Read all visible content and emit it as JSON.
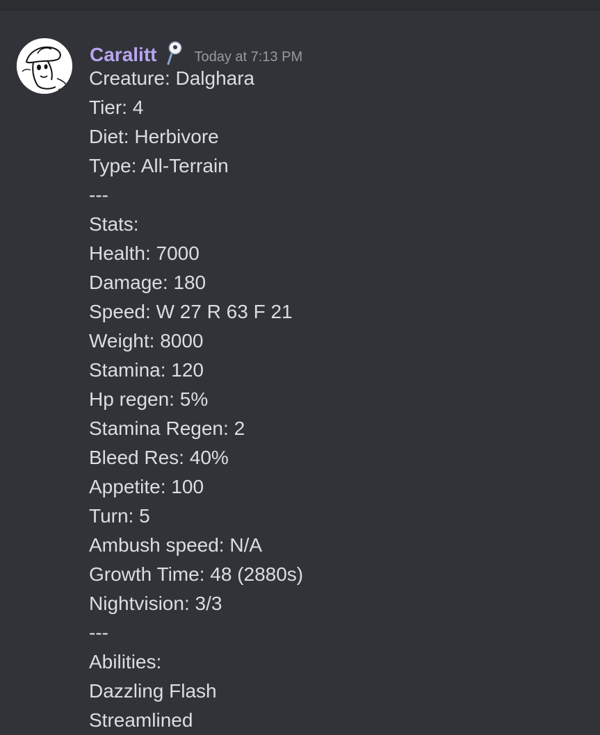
{
  "message": {
    "author": "Caralitt",
    "timestamp": "Today at 7:13 PM",
    "role_icon": "magnifier-pin-icon",
    "avatar_icon": "cartoon-character-avatar",
    "lines": [
      "Creature: Dalghara",
      "Tier: 4",
      "Diet: Herbivore",
      "Type: All-Terrain",
      "---",
      "Stats:",
      "Health: 7000",
      "Damage: 180",
      "Speed: W 27 R 63 F 21",
      "Weight: 8000",
      "Stamina: 120",
      "Hp regen: 5%",
      "Stamina Regen: 2",
      "Bleed Res: 40%",
      "Appetite: 100",
      "Turn: 5",
      "Ambush speed: N/A",
      "Growth Time: 48 (2880s)",
      "Nightvision: 3/3",
      "---",
      "Abilities:",
      "Dazzling Flash",
      "Streamlined"
    ]
  },
  "colors": {
    "background": "#313338",
    "topbar": "#2b2d31",
    "username": "#b8a5ef",
    "text": "#dbdee1",
    "timestamp": "#949ba4"
  }
}
